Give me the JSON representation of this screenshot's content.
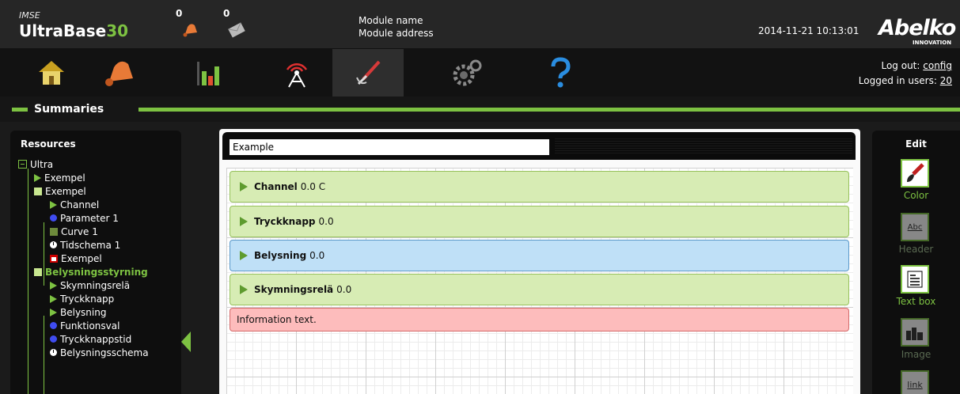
{
  "header": {
    "brand_top": "IMSE",
    "brand_name": "UltraBase",
    "brand_num": "30",
    "alarm_count": "0",
    "message_count": "0",
    "module_name": "Module name",
    "module_address": "Module address",
    "datetime": "2014-11-21 10:13:01",
    "logo": "Abelko",
    "logo_sub": "INNOVATION"
  },
  "nav": {
    "items": [
      {
        "name": "home-icon",
        "active": false
      },
      {
        "name": "alarm-bell-icon",
        "active": false
      },
      {
        "name": "chart-icon",
        "active": false
      },
      {
        "name": "antenna-icon",
        "active": false
      },
      {
        "name": "tools-icon",
        "active": true
      },
      {
        "name": "settings-gears-icon",
        "active": false
      },
      {
        "name": "help-icon",
        "active": false
      }
    ],
    "logout_label": "Log out:",
    "logout_user": "config",
    "logged_label": "Logged in users:",
    "logged_count": "20"
  },
  "section_title": "Summaries",
  "resources": {
    "title": "Resources",
    "tree": [
      "Ultra",
      "Exempel",
      "Exempel",
      "Channel",
      "Parameter 1",
      "Curve 1",
      "Tidschema 1",
      "Exempel",
      "Belysningsstyrning",
      "Skymningsrelä",
      "Tryckknapp",
      "Belysning",
      "Funktionsval",
      "Tryckknappstid",
      "Belysningsschema"
    ]
  },
  "canvas": {
    "title_value": "Example",
    "rows": [
      {
        "name": "Channel",
        "value": "0.0 C",
        "color": "green"
      },
      {
        "name": "Tryckknapp",
        "value": "0.0",
        "color": "green"
      },
      {
        "name": "Belysning",
        "value": "0.0",
        "color": "blue"
      },
      {
        "name": "Skymningsrelä",
        "value": "0.0",
        "color": "green"
      }
    ],
    "info_text": "Information text."
  },
  "edit": {
    "title": "Edit",
    "tools": [
      "Color",
      "Header",
      "Text box",
      "Image",
      "link"
    ],
    "header_icon_text": "Abc"
  },
  "colors": {
    "accent_green": "#7dc242",
    "row_green": "#d7ecb4",
    "row_blue": "#bfe0f7",
    "row_red": "#fdbcbc"
  }
}
